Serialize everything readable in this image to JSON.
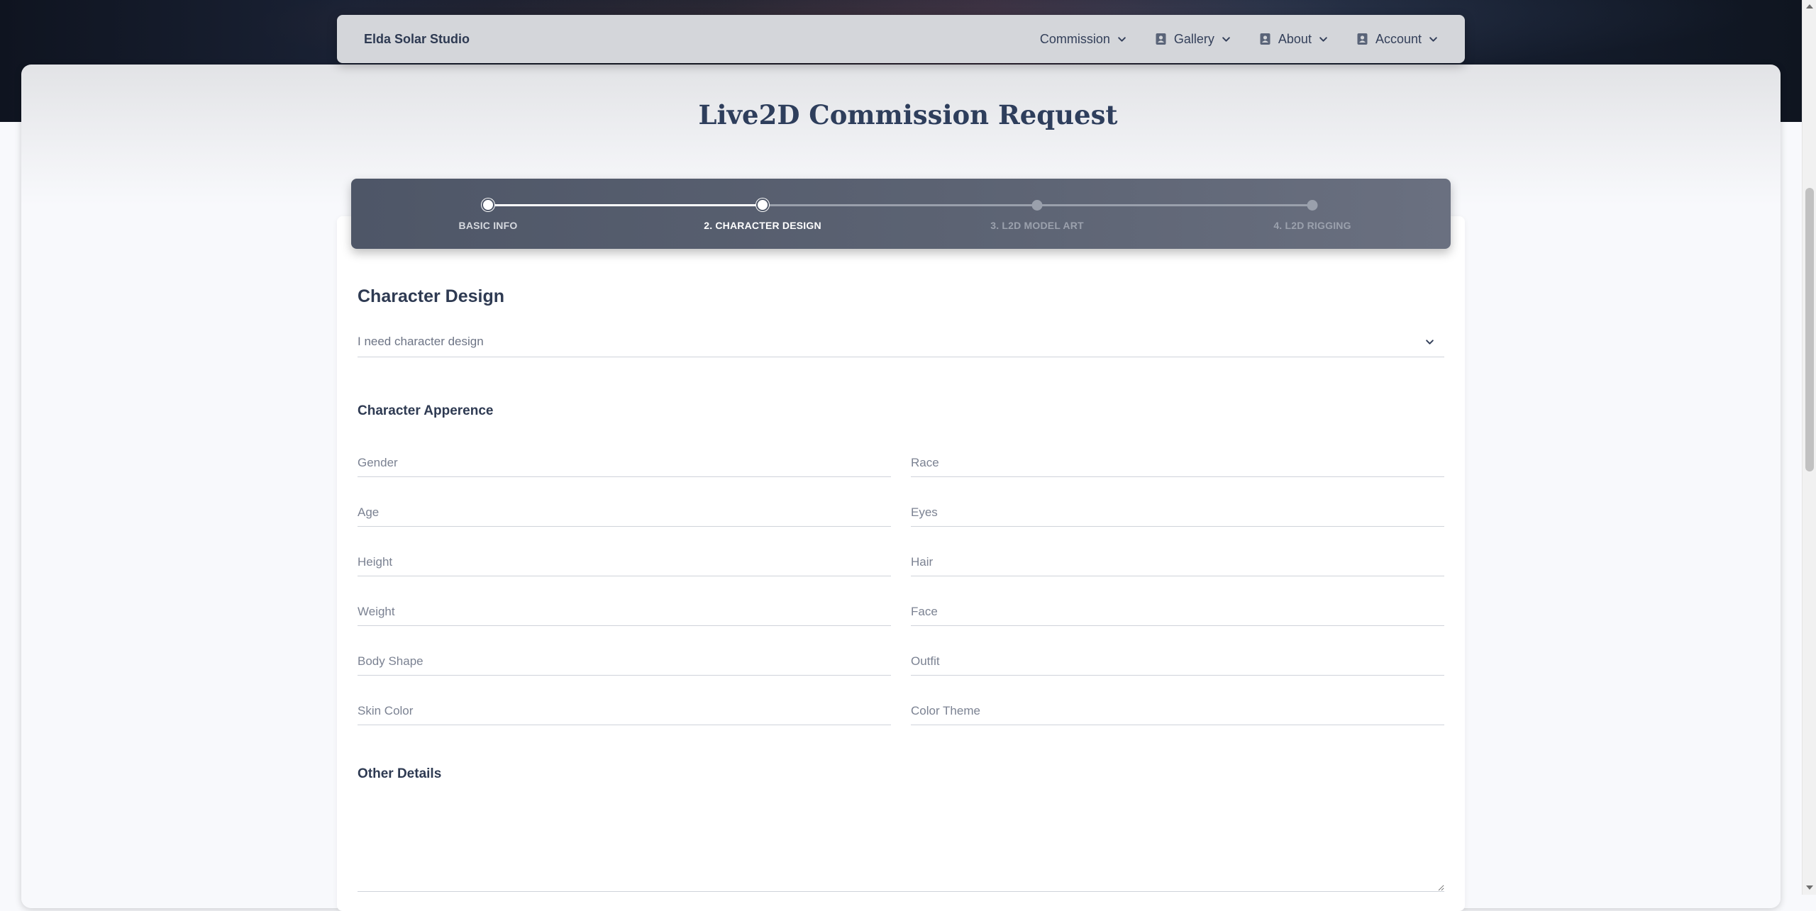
{
  "navbar": {
    "brand": "Elda Solar Studio",
    "items": [
      {
        "label": "Commission",
        "icon": "none"
      },
      {
        "label": "Gallery",
        "icon": "contact-card-icon"
      },
      {
        "label": "About",
        "icon": "contact-card-icon"
      },
      {
        "label": "Account",
        "icon": "contact-card-icon"
      }
    ]
  },
  "page": {
    "title": "Live2D Commission Request"
  },
  "stepper": {
    "current_step": 2,
    "steps": [
      {
        "label": "BASIC INFO",
        "state": "done"
      },
      {
        "label": "2. CHARACTER DESIGN",
        "state": "current"
      },
      {
        "label": "3. L2D MODEL ART",
        "state": "upcoming"
      },
      {
        "label": "4. L2D RIGGING",
        "state": "upcoming"
      }
    ]
  },
  "character_design": {
    "heading": "Character Design",
    "selected_option": "I need character design"
  },
  "appearance": {
    "heading": "Character Apperence",
    "fields": [
      {
        "placeholder": "Gender"
      },
      {
        "placeholder": "Race"
      },
      {
        "placeholder": "Age"
      },
      {
        "placeholder": "Eyes"
      },
      {
        "placeholder": "Height"
      },
      {
        "placeholder": "Hair"
      },
      {
        "placeholder": "Weight"
      },
      {
        "placeholder": "Face"
      },
      {
        "placeholder": "Body Shape"
      },
      {
        "placeholder": "Outfit"
      },
      {
        "placeholder": "Skin Color"
      },
      {
        "placeholder": "Color Theme"
      }
    ]
  },
  "other_details": {
    "heading": "Other Details"
  },
  "colors": {
    "text_primary": "#2e3a52",
    "stepper_bg": "#555d6e",
    "navbar_bg": "#d4d6da"
  }
}
